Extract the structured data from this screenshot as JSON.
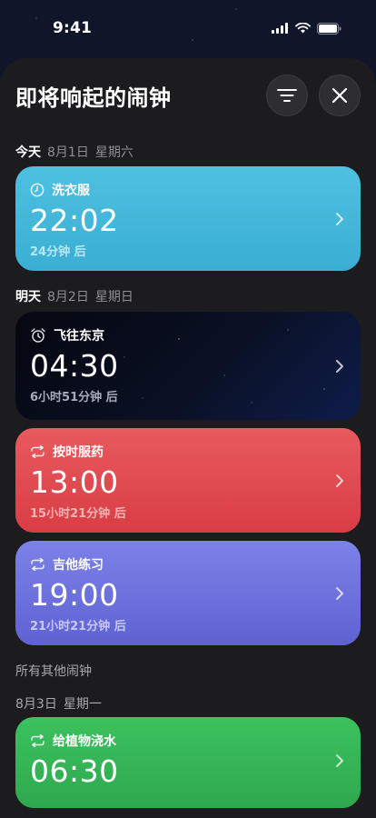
{
  "status_bar": {
    "time": "9:41"
  },
  "header": {
    "title": "即将响起的闹钟"
  },
  "sections": {
    "today": {
      "day": "今天",
      "date": "8月1日",
      "weekday": "星期六"
    },
    "tomorrow": {
      "day": "明天",
      "date": "8月2日",
      "weekday": "星期日"
    },
    "others": {
      "title": "所有其他闹钟"
    },
    "aug3": {
      "date": "8月3日",
      "weekday": "星期一"
    }
  },
  "alarms": [
    {
      "name": "洗衣服",
      "time": "22:02",
      "remaining": "24分钟 后",
      "icon": "clock-icon",
      "color": "#4fc0e0"
    },
    {
      "name": "飞往东京",
      "time": "04:30",
      "remaining": "6小时51分钟 后",
      "icon": "alarm-clock-icon",
      "color": "#0a1024"
    },
    {
      "name": "按时服药",
      "time": "13:00",
      "remaining": "15小时21分钟 后",
      "icon": "repeat-icon",
      "color": "#e85a5e"
    },
    {
      "name": "吉他练习",
      "time": "19:00",
      "remaining": "21小时21分钟 后",
      "icon": "repeat-icon",
      "color": "#7c82e8"
    },
    {
      "name": "给植物浇水",
      "time": "06:30",
      "remaining": "",
      "icon": "repeat-icon",
      "color": "#3cc25f"
    }
  ]
}
